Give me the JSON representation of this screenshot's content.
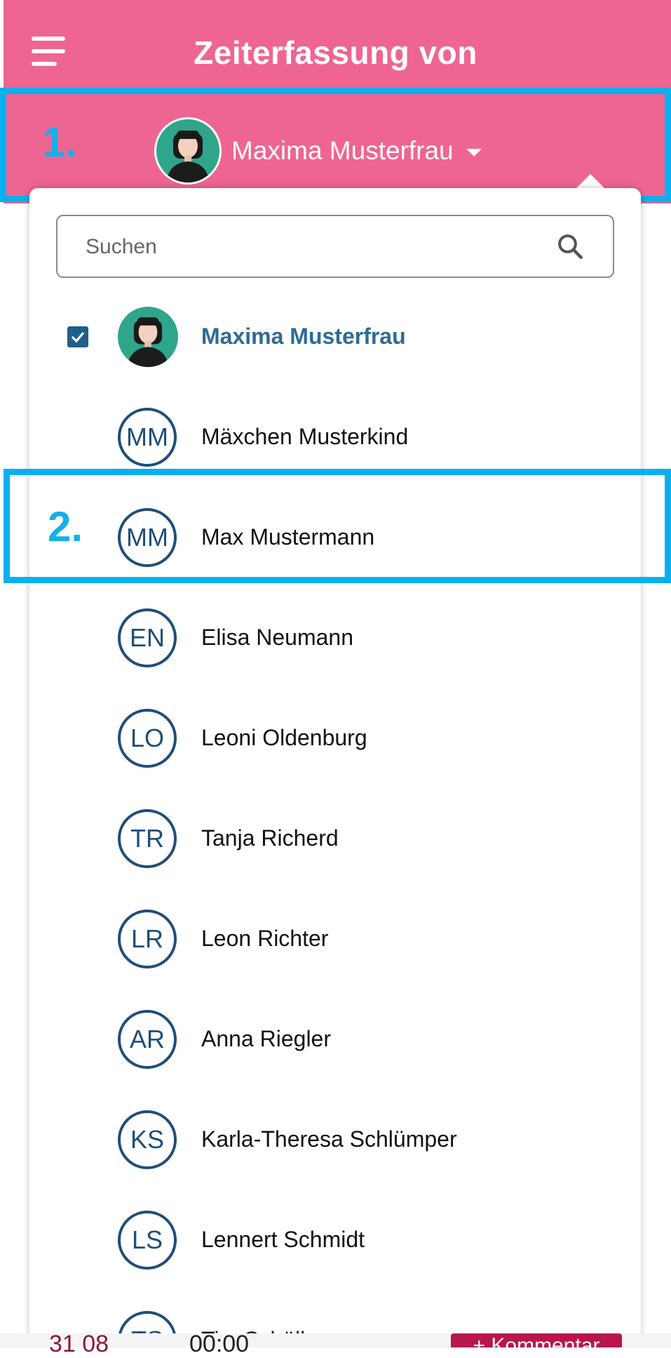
{
  "header": {
    "title": "Zeiterfassung von",
    "selected_user": "Maxima Musterfrau"
  },
  "annotations": {
    "step1": "1.",
    "step2": "2."
  },
  "search": {
    "placeholder": "Suchen"
  },
  "users": [
    {
      "name": "Maxima Musterfrau",
      "initials": "",
      "selected": true,
      "photo": true
    },
    {
      "name": "Mäxchen Musterkind",
      "initials": "MM"
    },
    {
      "name": "Max Mustermann",
      "initials": "MM"
    },
    {
      "name": "Elisa Neumann",
      "initials": "EN"
    },
    {
      "name": "Leoni Oldenburg",
      "initials": "LO"
    },
    {
      "name": "Tanja Richerd",
      "initials": "TR"
    },
    {
      "name": "Leon Richter",
      "initials": "LR"
    },
    {
      "name": "Anna Riegler",
      "initials": "AR"
    },
    {
      "name": "Karla-Theresa Schlümper",
      "initials": "KS"
    },
    {
      "name": "Lennert Schmidt",
      "initials": "LS"
    },
    {
      "name": "Tim Schöller",
      "initials": "TS"
    }
  ],
  "background": {
    "date_fragment": "31 08",
    "time_fragment": "00:00",
    "comment_button": "+ Kommentar"
  },
  "colors": {
    "header": "#ef6591",
    "highlight": "#0ab0ee",
    "avatar_ring": "#1f4e79",
    "selected_text": "#2e6b95"
  }
}
